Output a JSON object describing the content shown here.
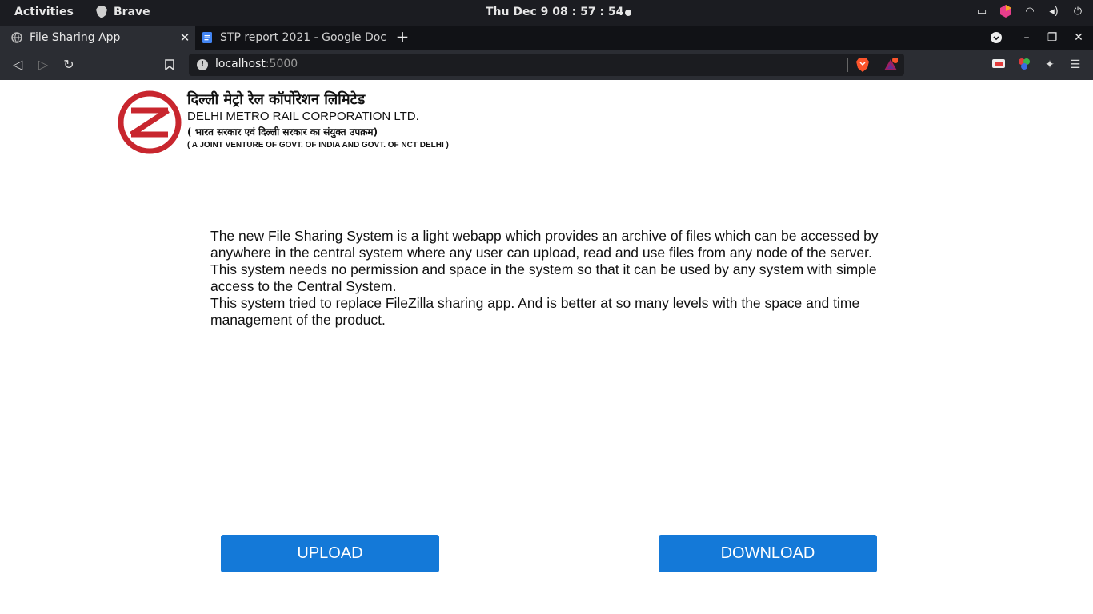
{
  "system_bar": {
    "activities": "Activities",
    "app_name": "Brave",
    "clock": "Thu Dec 9  08 : 57 : 54"
  },
  "tabs": [
    {
      "title": "File Sharing App",
      "icon": "globe-icon"
    },
    {
      "title": "STP report 2021 - Google Doc",
      "icon": "google-docs-icon"
    }
  ],
  "address_bar": {
    "host": "localhost",
    "port": ":5000"
  },
  "header": {
    "org_hindi": "दिल्ली मेट्रो रेल कॉर्पोरेशन लिमिटेड",
    "org_english": "DELHI METRO RAIL CORPORATION LTD.",
    "subtitle_hindi": "( भारत सरकार एवं दिल्ली सरकार का संयुक्त उपक्रम)",
    "subtitle_english": "( A JOINT VENTURE OF GOVT. OF INDIA AND GOVT. OF NCT DELHI )"
  },
  "intro": {
    "line1": "The new File Sharing System is a light webapp which provides an archive of files which can be accessed by anywhere in the central system where any user can upload, read and use files from any node of the server.",
    "line2": "This system needs no permission and space in the system so that it can be used by any system with simple access to the Central System.",
    "line3": "This system tried to replace FileZilla sharing app. And is better at so many levels with the space and time management of the product."
  },
  "actions": {
    "upload": "UPLOAD",
    "download": "DOWNLOAD"
  },
  "colors": {
    "button": "#1479d8",
    "logo_red": "#c8262e"
  }
}
